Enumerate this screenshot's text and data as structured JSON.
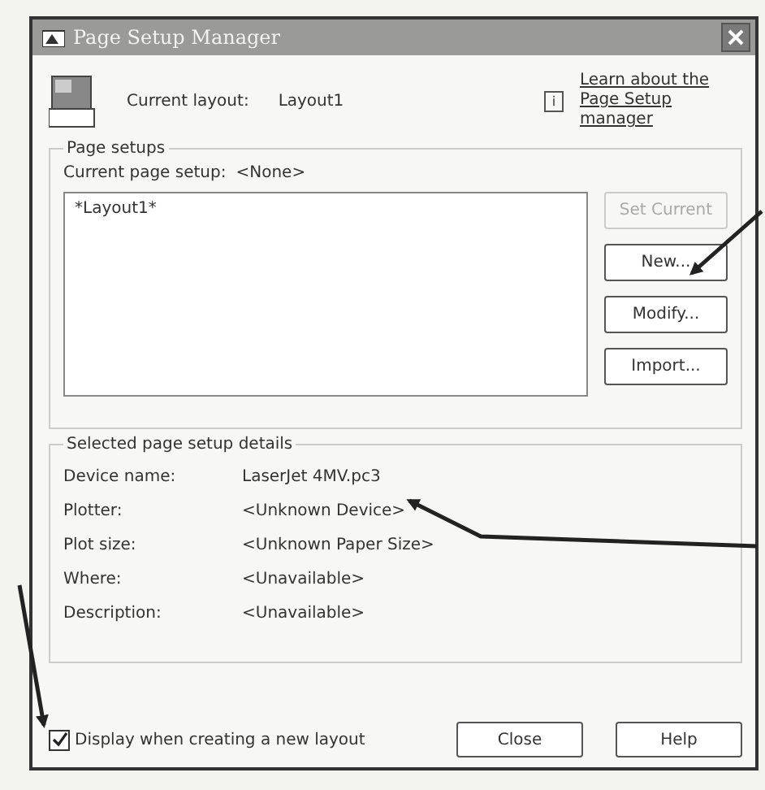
{
  "window": {
    "title": "Page Setup Manager"
  },
  "current_layout": {
    "label": "Current layout:",
    "value": "Layout1"
  },
  "help_link": {
    "icon": "i",
    "text": "Learn about the Page Setup manager"
  },
  "page_setups": {
    "label": "Page setups",
    "current_label": "Current page setup:",
    "current_value": "<None>",
    "items": [
      {
        "text": "*Layout1*",
        "selected": false
      }
    ],
    "buttons": [
      {
        "label": "Set Current",
        "disabled": true
      },
      {
        "label": "New...",
        "disabled": false
      },
      {
        "label": "Modify...",
        "disabled": false
      },
      {
        "label": "Import...",
        "disabled": false
      }
    ]
  },
  "details": {
    "label": "Selected page setup details",
    "rows": [
      {
        "label": "Device name:",
        "value": "LaserJet 4MV.pc3"
      },
      {
        "label": "Plotter:",
        "value": "<Unknown Device>"
      },
      {
        "label": "Plot size:",
        "value": "<Unknown Paper Size>"
      },
      {
        "label": "Where:",
        "value": "<Unavailable>"
      },
      {
        "label": "Description:",
        "value": "<Unavailable>"
      }
    ]
  },
  "display_checkbox": {
    "label": "Display when creating a new layout",
    "checked": true
  },
  "buttons": [
    "Close",
    "Help"
  ]
}
